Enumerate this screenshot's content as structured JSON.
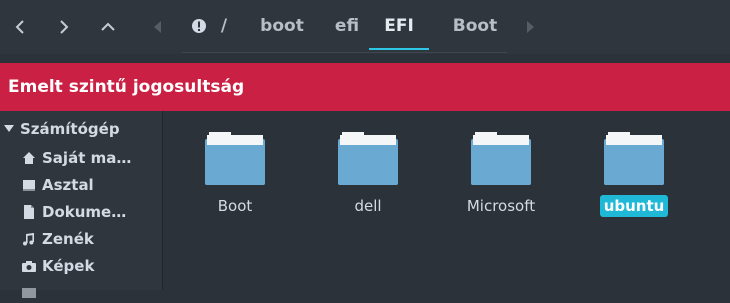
{
  "nav": {
    "back_icon": "chevron-left-icon",
    "forward_icon": "chevron-right-icon",
    "up_icon": "chevron-up-icon"
  },
  "path": {
    "root_icon": "warning-icon",
    "separator": "/",
    "crumbs": [
      {
        "label": "boot"
      },
      {
        "label": "efi"
      },
      {
        "label": "EFI",
        "active": true
      },
      {
        "label": "Boot"
      }
    ]
  },
  "warning": {
    "text": "Emelt szintű jogosultság",
    "color": "#ca2043"
  },
  "sidebar": {
    "header": "Számítógép",
    "items": [
      {
        "label": "Saját ma…",
        "icon": "home-icon"
      },
      {
        "label": "Asztal",
        "icon": "desktop-icon"
      },
      {
        "label": "Dokume…",
        "icon": "document-icon"
      },
      {
        "label": "Zenék",
        "icon": "music-icon"
      },
      {
        "label": "Képek",
        "icon": "camera-icon"
      }
    ]
  },
  "files": [
    {
      "name": "Boot"
    },
    {
      "name": "dell"
    },
    {
      "name": "Microsoft"
    },
    {
      "name": "ubuntu",
      "selected": true
    }
  ],
  "colors": {
    "accent": "#2ec6e5",
    "selection": "#1fb8d6",
    "folder": "#6aa9d1"
  }
}
